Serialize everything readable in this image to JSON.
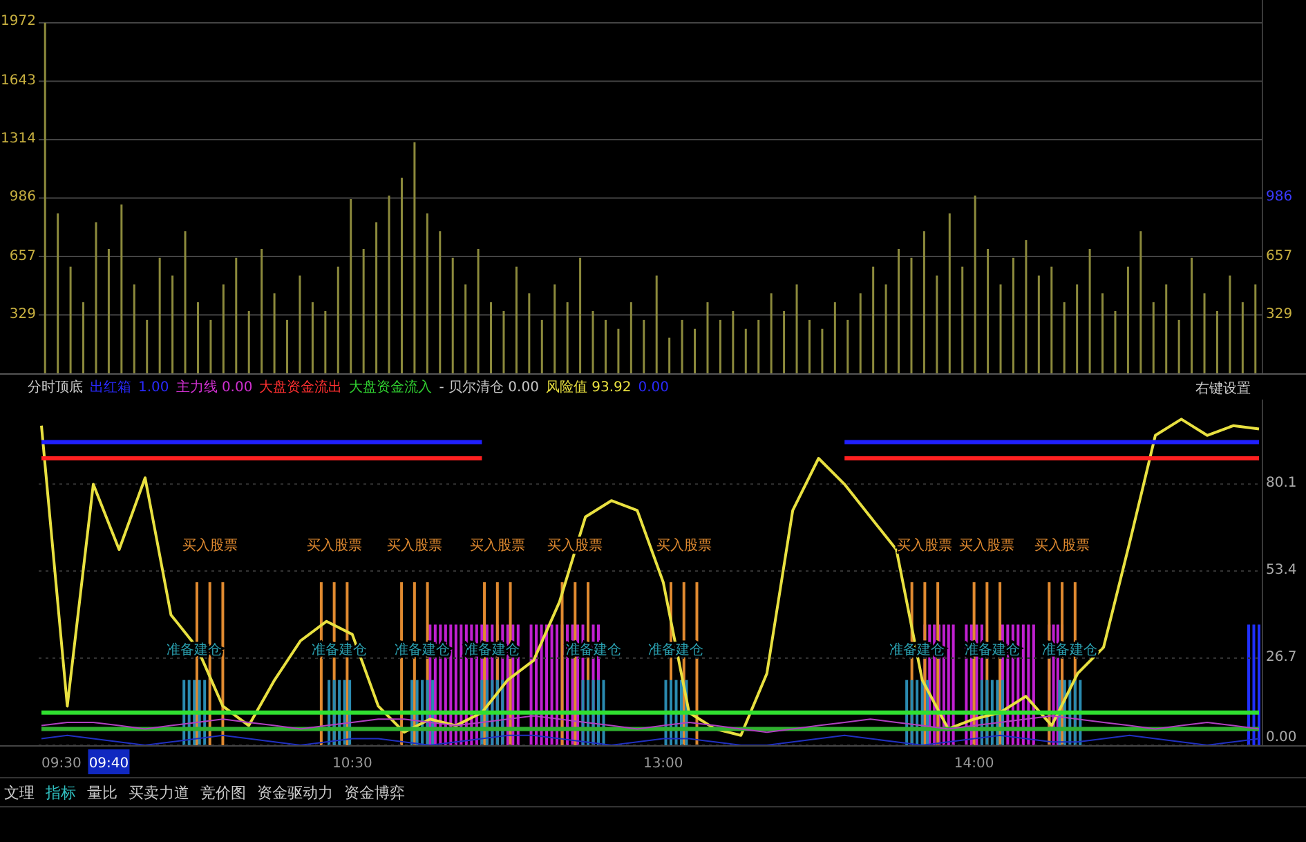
{
  "volume_chart": {
    "chart_data": {
      "type": "bar",
      "grid": true,
      "ylim": [
        0,
        2100
      ],
      "yticks": [
        {
          "value": 329,
          "label": "329"
        },
        {
          "value": 657,
          "label": "657"
        },
        {
          "value": 986,
          "label": "986"
        },
        {
          "value": 1314,
          "label": "1314"
        },
        {
          "value": 1643,
          "label": "1643"
        },
        {
          "value": 1972,
          "label": "1972"
        }
      ],
      "series": [
        {
          "color": "#8c8a3c",
          "values": [
            1972,
            900,
            600,
            400,
            850,
            700,
            950,
            500,
            300,
            650,
            550,
            800,
            400,
            300,
            500,
            650,
            350,
            700,
            450,
            300,
            550,
            400,
            350,
            600,
            980,
            700,
            850,
            1000,
            1100,
            1300,
            900,
            800,
            650,
            500,
            700,
            400,
            350,
            600,
            450,
            300,
            500,
            400,
            650,
            350,
            300,
            250,
            400,
            300,
            550,
            200,
            300,
            250,
            400,
            300,
            350,
            250,
            300,
            450,
            350,
            500,
            300,
            250,
            400,
            300,
            450,
            600,
            500,
            700,
            650,
            800,
            550,
            900,
            600,
            1000,
            700,
            500,
            650,
            750,
            550,
            600,
            400,
            500,
            700,
            450,
            350,
            600,
            800,
            400,
            500,
            300,
            650,
            450,
            350,
            550,
            400,
            500
          ]
        }
      ]
    },
    "right_labels": [
      {
        "text": "986",
        "color": "#3a3aff"
      },
      {
        "text": "657",
        "color": "#c8b040"
      },
      {
        "text": "329",
        "color": "#c8b040"
      }
    ]
  },
  "legend": [
    {
      "text": "分时顶底",
      "color": "#c8c8c8"
    },
    {
      "text": "出红箱",
      "color": "#2a2aff"
    },
    {
      "text": "1.00",
      "color": "#2a2aff"
    },
    {
      "text": "主力线 0.00",
      "color": "#d030d0"
    },
    {
      "text": "大盘资金流出",
      "color": "#ff3030"
    },
    {
      "text": "大盘资金流入",
      "color": "#30d030"
    },
    {
      "text": "- 贝尔清仓 0.00",
      "color": "#c8c8c8"
    },
    {
      "text": "风险值 93.92",
      "color": "#e8e040"
    },
    {
      "text": "0.00",
      "color": "#2a2aff"
    }
  ],
  "settings_label": "右键设置",
  "signal_chart": {
    "chart_data": {
      "type": "line",
      "grid": true,
      "ylim": [
        0,
        106
      ],
      "yticks": [
        {
          "value": 0,
          "label": "0.00"
        },
        {
          "value": 26.7,
          "label": "26.7"
        },
        {
          "value": 53.4,
          "label": "53.4"
        },
        {
          "value": 80.1,
          "label": "80.1"
        }
      ],
      "series": [
        {
          "color": "#e8e040",
          "values": [
            98,
            12,
            80,
            60,
            82,
            40,
            30,
            12,
            6,
            20,
            32,
            38,
            34,
            12,
            4,
            8,
            6,
            10,
            20,
            26,
            44,
            70,
            75,
            72,
            50,
            10,
            5,
            3,
            22,
            72,
            88,
            80,
            70,
            60,
            20,
            5,
            8,
            10,
            15,
            6,
            22,
            30,
            62,
            95,
            100,
            95,
            98,
            97
          ]
        },
        {
          "color": "#2020ff",
          "values": [
            93,
            93,
            93,
            93,
            93,
            93,
            93,
            93,
            93,
            93,
            93,
            93,
            93,
            93,
            93,
            93,
            93,
            93,
            null,
            null,
            null,
            null,
            null,
            null,
            null,
            null,
            null,
            null,
            null,
            null,
            null,
            93,
            93,
            93,
            93,
            93,
            93,
            93,
            93,
            93,
            93,
            93,
            93,
            93,
            93,
            93,
            93,
            93
          ]
        },
        {
          "color": "#ff2020",
          "values": [
            88,
            88,
            88,
            88,
            88,
            88,
            88,
            88,
            88,
            88,
            88,
            88,
            88,
            88,
            88,
            88,
            88,
            88,
            null,
            null,
            null,
            null,
            null,
            null,
            null,
            null,
            null,
            null,
            null,
            null,
            null,
            88,
            88,
            88,
            88,
            88,
            88,
            88,
            88,
            88,
            88,
            88,
            88,
            88,
            88,
            88,
            88,
            88
          ]
        },
        {
          "color": "#30e030",
          "values": [
            10,
            10,
            10,
            10,
            10,
            10,
            10,
            10,
            10,
            10,
            10,
            10,
            10,
            10,
            10,
            10,
            10,
            10,
            10,
            10,
            10,
            10,
            10,
            10,
            10,
            10,
            10,
            10,
            10,
            10,
            10,
            10,
            10,
            10,
            10,
            10,
            10,
            10,
            10,
            10,
            10,
            10,
            10,
            10,
            10,
            10,
            10,
            10
          ]
        },
        {
          "color": "#30b030",
          "values": [
            5,
            5,
            5,
            5,
            5,
            5,
            5,
            5,
            5,
            5,
            5,
            5,
            5,
            5,
            5,
            5,
            5,
            5,
            5,
            5,
            5,
            5,
            5,
            5,
            5,
            5,
            5,
            5,
            5,
            5,
            5,
            5,
            5,
            5,
            5,
            5,
            5,
            5,
            5,
            5,
            5,
            5,
            5,
            5,
            5,
            5,
            5,
            5
          ]
        },
        {
          "color": "#b040c0",
          "values": [
            6,
            7,
            7,
            6,
            5,
            6,
            7,
            8,
            7,
            6,
            5,
            6,
            7,
            8,
            8,
            7,
            6,
            7,
            8,
            9,
            8,
            7,
            6,
            5,
            6,
            7,
            6,
            5,
            4,
            5,
            6,
            7,
            8,
            7,
            6,
            5,
            6,
            7,
            8,
            9,
            8,
            7,
            6,
            5,
            6,
            7,
            6,
            5
          ]
        },
        {
          "color": "#2030c0",
          "values": [
            2,
            3,
            2,
            1,
            0,
            1,
            2,
            3,
            2,
            1,
            0,
            1,
            2,
            2,
            1,
            0,
            1,
            2,
            3,
            3,
            2,
            1,
            0,
            1,
            2,
            2,
            1,
            0,
            0,
            1,
            2,
            3,
            2,
            1,
            0,
            1,
            2,
            3,
            2,
            1,
            1,
            2,
            3,
            2,
            1,
            0,
            1,
            2
          ]
        }
      ]
    },
    "signals": [
      {
        "kind": "buy",
        "text": "买入股票"
      },
      {
        "kind": "buy",
        "text": "买入股票"
      },
      {
        "kind": "buy",
        "text": "买入股票"
      },
      {
        "kind": "buy",
        "text": "买入股票"
      },
      {
        "kind": "buy",
        "text": "买入股票"
      },
      {
        "kind": "buy",
        "text": "买入股票"
      },
      {
        "kind": "buy",
        "text": "买入股票"
      },
      {
        "kind": "buy",
        "text": "买入股票"
      },
      {
        "kind": "buy",
        "text": "买入股票"
      },
      {
        "kind": "prepare",
        "text": "准备建仓"
      },
      {
        "kind": "prepare",
        "text": "准备建仓"
      },
      {
        "kind": "prepare",
        "text": "准备建仓"
      },
      {
        "kind": "prepare",
        "text": "准备建仓"
      },
      {
        "kind": "prepare",
        "text": "准备建仓"
      },
      {
        "kind": "prepare",
        "text": "准备建仓"
      },
      {
        "kind": "prepare",
        "text": "准备建仓"
      },
      {
        "kind": "prepare",
        "text": "准备建仓"
      },
      {
        "kind": "prepare",
        "text": "准备建仓"
      }
    ],
    "time_labels": [
      "09:30",
      "10:30",
      "13:00",
      "14:00"
    ],
    "cursor_label": "09:40"
  },
  "tabs": [
    {
      "label": "文理",
      "selected": false
    },
    {
      "label": "指标",
      "selected": true
    },
    {
      "label": "量比",
      "selected": false
    },
    {
      "label": "买卖力道",
      "selected": false
    },
    {
      "label": "竞价图",
      "selected": false
    },
    {
      "label": "资金驱动力",
      "selected": false
    },
    {
      "label": "资金博弈",
      "selected": false
    }
  ]
}
